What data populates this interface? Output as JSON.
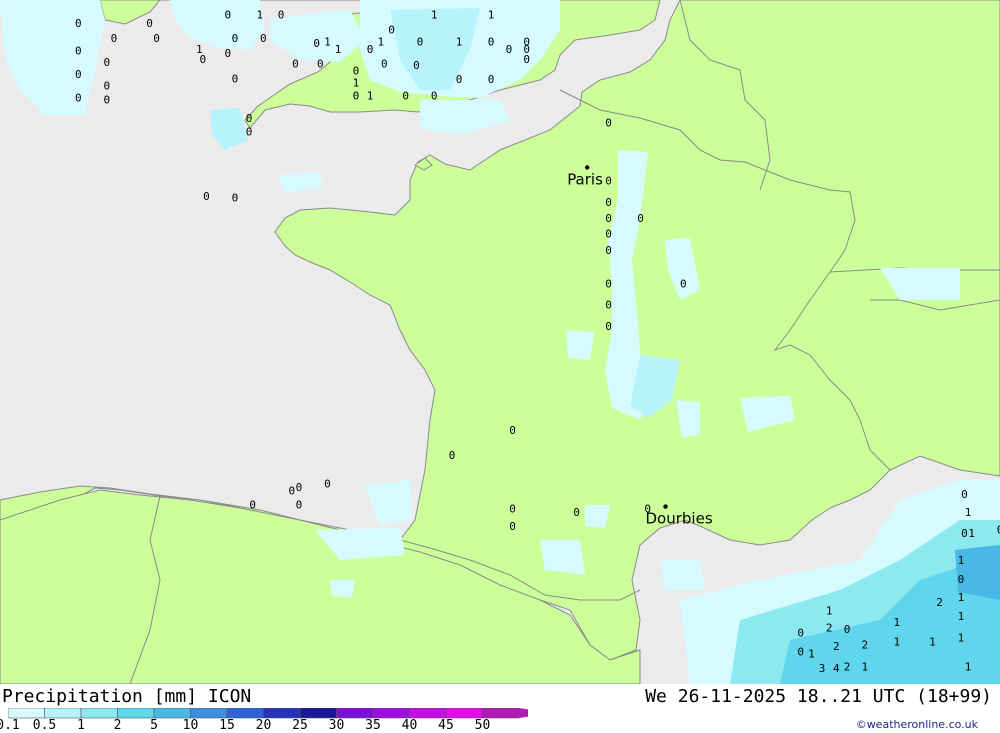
{
  "legend": {
    "title": "Precipitation [mm] ICON",
    "ticks": [
      "0.1",
      "0.5",
      "1",
      "2",
      "5",
      "10",
      "15",
      "20",
      "25",
      "30",
      "35",
      "40",
      "45",
      "50"
    ],
    "colors": [
      "#d6fbff",
      "#b7f3fb",
      "#8ce9f0",
      "#5fd6ec",
      "#49b8e6",
      "#3c8fde",
      "#2f62d6",
      "#2434b8",
      "#161a95",
      "#7a0fd9",
      "#9d0ce0",
      "#c40ee4",
      "#e30fe6",
      "#b21ab8"
    ]
  },
  "timestamp": "We 26-11-2025 18..21 UTC (18+99)",
  "credit": "©weatheronline.co.uk",
  "colors": {
    "sea": "#ebebeb",
    "land": "#ccff99",
    "border": "#999999"
  },
  "cities": [
    {
      "name": "Paris",
      "lon": 2.35,
      "lat": 48.86
    },
    {
      "name": "Dourbies",
      "lon": 3.45,
      "lat": 44.08
    }
  ],
  "precip_labels": [
    {
      "v": "0",
      "lon": -2.7,
      "lat": 50.96
    },
    {
      "v": "1",
      "lon": -2.25,
      "lat": 50.96
    },
    {
      "v": "0",
      "lon": -1.95,
      "lat": 50.96
    },
    {
      "v": "0",
      "lon": -4.8,
      "lat": 50.84
    },
    {
      "v": "0",
      "lon": -3.8,
      "lat": 50.84
    },
    {
      "v": "0",
      "lon": -3.7,
      "lat": 50.63
    },
    {
      "v": "0",
      "lon": -4.3,
      "lat": 50.63
    },
    {
      "v": "0",
      "lon": -2.6,
      "lat": 50.63
    },
    {
      "v": "0",
      "lon": -2.2,
      "lat": 50.63
    },
    {
      "v": "1",
      "lon": -3.1,
      "lat": 50.47
    },
    {
      "v": "0",
      "lon": -2.7,
      "lat": 50.42
    },
    {
      "v": "0",
      "lon": -1.45,
      "lat": 50.56
    },
    {
      "v": "1",
      "lon": -1.3,
      "lat": 50.58
    },
    {
      "v": "1",
      "lon": -0.55,
      "lat": 50.58
    },
    {
      "v": "0",
      "lon": 0.0,
      "lat": 50.58
    },
    {
      "v": "1",
      "lon": 0.55,
      "lat": 50.58
    },
    {
      "v": "0",
      "lon": 1.0,
      "lat": 50.58
    },
    {
      "v": "0",
      "lon": 1.5,
      "lat": 50.58
    },
    {
      "v": "0",
      "lon": -0.4,
      "lat": 50.75
    },
    {
      "v": "1",
      "lon": 0.2,
      "lat": 50.96
    },
    {
      "v": "1",
      "lon": 1.0,
      "lat": 50.96
    },
    {
      "v": "0",
      "lon": -4.8,
      "lat": 50.45
    },
    {
      "v": "0",
      "lon": -4.4,
      "lat": 50.29
    },
    {
      "v": "0",
      "lon": -4.8,
      "lat": 50.12
    },
    {
      "v": "0",
      "lon": -4.4,
      "lat": 49.96
    },
    {
      "v": "0",
      "lon": -4.8,
      "lat": 49.79
    },
    {
      "v": "0",
      "lon": -4.4,
      "lat": 49.76
    },
    {
      "v": "0",
      "lon": -3.05,
      "lat": 50.33
    },
    {
      "v": "0",
      "lon": -2.6,
      "lat": 50.06
    },
    {
      "v": "0",
      "lon": -1.75,
      "lat": 50.27
    },
    {
      "v": "0",
      "lon": -1.4,
      "lat": 50.27
    },
    {
      "v": "0",
      "lon": -0.5,
      "lat": 50.27
    },
    {
      "v": "0",
      "lon": -0.05,
      "lat": 50.25
    },
    {
      "v": "1",
      "lon": -1.15,
      "lat": 50.47
    },
    {
      "v": "0",
      "lon": -0.7,
      "lat": 50.47
    },
    {
      "v": "0",
      "lon": 1.25,
      "lat": 50.47
    },
    {
      "v": "0",
      "lon": 1.5,
      "lat": 50.47
    },
    {
      "v": "0",
      "lon": -0.9,
      "lat": 50.17
    },
    {
      "v": "1",
      "lon": -0.9,
      "lat": 50.0
    },
    {
      "v": "0",
      "lon": -0.9,
      "lat": 49.82
    },
    {
      "v": "1",
      "lon": -0.7,
      "lat": 49.82
    },
    {
      "v": "0",
      "lon": -0.2,
      "lat": 49.82
    },
    {
      "v": "0",
      "lon": 0.2,
      "lat": 49.82
    },
    {
      "v": "0",
      "lon": 0.55,
      "lat": 50.05
    },
    {
      "v": "0",
      "lon": 1.0,
      "lat": 50.05
    },
    {
      "v": "0",
      "lon": 1.5,
      "lat": 50.33
    },
    {
      "v": "0",
      "lon": -2.4,
      "lat": 49.5
    },
    {
      "v": "0",
      "lon": -2.4,
      "lat": 49.31
    },
    {
      "v": "0",
      "lon": 2.65,
      "lat": 49.44
    },
    {
      "v": "0",
      "lon": -3.0,
      "lat": 48.4
    },
    {
      "v": "0",
      "lon": -2.6,
      "lat": 48.38
    },
    {
      "v": "0",
      "lon": 2.65,
      "lat": 48.62
    },
    {
      "v": "0",
      "lon": 2.65,
      "lat": 48.32
    },
    {
      "v": "0",
      "lon": 2.65,
      "lat": 48.09
    },
    {
      "v": "0",
      "lon": 3.1,
      "lat": 48.09
    },
    {
      "v": "0",
      "lon": 2.65,
      "lat": 47.87
    },
    {
      "v": "0",
      "lon": 2.65,
      "lat": 47.64
    },
    {
      "v": "0",
      "lon": 2.65,
      "lat": 47.17
    },
    {
      "v": "0",
      "lon": 3.7,
      "lat": 47.17
    },
    {
      "v": "0",
      "lon": 2.65,
      "lat": 46.87
    },
    {
      "v": "0",
      "lon": 2.65,
      "lat": 46.57
    },
    {
      "v": "0",
      "lon": 7.65,
      "lat": 44.2
    },
    {
      "v": "1",
      "lon": 7.7,
      "lat": 43.95
    },
    {
      "v": "0",
      "lon": 2.2,
      "lat": 43.95
    },
    {
      "v": "0",
      "lon": 7.65,
      "lat": 43.65
    },
    {
      "v": "1",
      "lon": 7.75,
      "lat": 43.65
    },
    {
      "v": "0",
      "lon": 8.15,
      "lat": 43.7
    },
    {
      "v": "1",
      "lon": 7.6,
      "lat": 43.27
    },
    {
      "v": "3",
      "lon": 8.2,
      "lat": 43.51
    },
    {
      "v": "4",
      "lon": 8.2,
      "lat": 43.24
    },
    {
      "v": "0",
      "lon": 7.6,
      "lat": 43.0
    },
    {
      "v": "2",
      "lon": 8.2,
      "lat": 42.9
    },
    {
      "v": "1",
      "lon": 7.6,
      "lat": 42.75
    },
    {
      "v": "0",
      "lon": 8.2,
      "lat": 42.58
    },
    {
      "v": "1",
      "lon": 6.7,
      "lat": 42.4
    },
    {
      "v": "2",
      "lon": 7.3,
      "lat": 42.68
    },
    {
      "v": "1",
      "lon": 7.6,
      "lat": 42.48
    },
    {
      "v": "1",
      "lon": 7.6,
      "lat": 42.18
    },
    {
      "v": "0",
      "lon": 8.2,
      "lat": 42.28
    },
    {
      "v": "0",
      "lon": 6.0,
      "lat": 42.3
    },
    {
      "v": "0",
      "lon": 5.35,
      "lat": 42.25
    },
    {
      "v": "2",
      "lon": 5.75,
      "lat": 42.32
    },
    {
      "v": "1",
      "lon": 5.75,
      "lat": 42.56
    },
    {
      "v": "2",
      "lon": 5.85,
      "lat": 42.06
    },
    {
      "v": "2",
      "lon": 6.25,
      "lat": 42.08
    },
    {
      "v": "1",
      "lon": 6.7,
      "lat": 42.12
    },
    {
      "v": "1",
      "lon": 7.2,
      "lat": 42.12
    },
    {
      "v": "0",
      "lon": 5.35,
      "lat": 41.98
    },
    {
      "v": "1",
      "lon": 5.5,
      "lat": 41.95
    },
    {
      "v": "1",
      "lon": 6.25,
      "lat": 41.77
    },
    {
      "v": "2",
      "lon": 6.0,
      "lat": 41.77
    },
    {
      "v": "1",
      "lon": 7.7,
      "lat": 41.77
    },
    {
      "v": "3",
      "lon": 5.65,
      "lat": 41.75
    },
    {
      "v": "4",
      "lon": 5.85,
      "lat": 41.75
    },
    {
      "v": "1",
      "lon": 8.2,
      "lat": 42.0
    },
    {
      "v": "0",
      "lon": -1.7,
      "lat": 44.3
    },
    {
      "v": "0",
      "lon": -2.35,
      "lat": 44.05
    },
    {
      "v": "0",
      "lon": -1.7,
      "lat": 44.05
    },
    {
      "v": "0",
      "lon": 1.3,
      "lat": 44.0
    },
    {
      "v": "0",
      "lon": 3.2,
      "lat": 44.0
    },
    {
      "v": "0",
      "lon": -1.8,
      "lat": 44.25
    },
    {
      "v": "0",
      "lon": -1.3,
      "lat": 44.35
    },
    {
      "v": "0",
      "lon": 0.45,
      "lat": 44.75
    },
    {
      "v": "0",
      "lon": 1.3,
      "lat": 45.1
    },
    {
      "v": "0",
      "lon": 1.3,
      "lat": 43.75
    }
  ]
}
